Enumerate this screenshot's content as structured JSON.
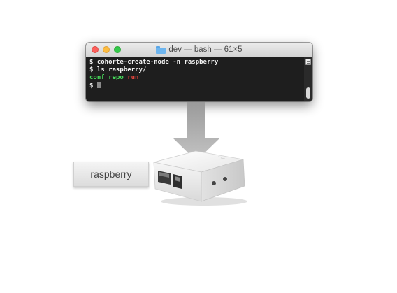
{
  "terminal": {
    "title": "dev — bash — 61×5",
    "lines": [
      {
        "prompt": "$",
        "command": "cohorte-create-node -n raspberry"
      },
      {
        "prompt": "$",
        "command": "ls raspberry/"
      }
    ],
    "ls_output": [
      "conf",
      "repo",
      "run"
    ],
    "last_prompt": "$",
    "colors": {
      "background": "#1e1e1e",
      "text": "#f2f2f2",
      "directory": "#46d85a",
      "executable": "#e0443c"
    }
  },
  "label": {
    "text": "raspberry"
  },
  "icons": {
    "folder": "folder-icon",
    "arrow": "arrow-down-icon",
    "device": "raspberry-pi-case-icon"
  }
}
